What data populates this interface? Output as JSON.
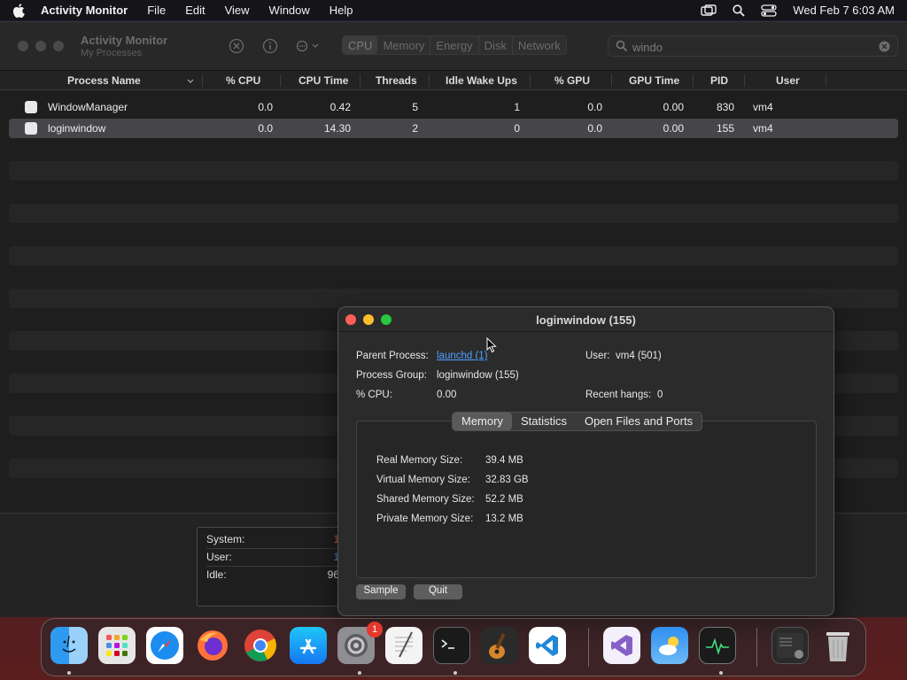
{
  "menubar": {
    "app_name": "Activity Monitor",
    "items": [
      "File",
      "Edit",
      "View",
      "Window",
      "Help"
    ],
    "clock": "Wed Feb 7  6:03 AM"
  },
  "toolbar": {
    "title": "Activity Monitor",
    "subtitle": "My Processes",
    "tabs": [
      "CPU",
      "Memory",
      "Energy",
      "Disk",
      "Network"
    ],
    "active_tab": "CPU",
    "search_value": "windo"
  },
  "table": {
    "columns": [
      "Process Name",
      "% CPU",
      "CPU Time",
      "Threads",
      "Idle Wake Ups",
      "% GPU",
      "GPU Time",
      "PID",
      "User"
    ],
    "rows": [
      {
        "name": "WindowManager",
        "cpu": "0.0",
        "cpu_time": "0.42",
        "threads": "5",
        "idle_wake": "1",
        "gpu": "0.0",
        "gpu_time": "0.00",
        "pid": "830",
        "user": "vm4"
      },
      {
        "name": "loginwindow",
        "cpu": "0.0",
        "cpu_time": "14.30",
        "threads": "2",
        "idle_wake": "0",
        "gpu": "0.0",
        "gpu_time": "0.00",
        "pid": "155",
        "user": "vm4"
      }
    ]
  },
  "cpu_load": {
    "system_label": "System:",
    "system_value": "1",
    "user_label": "User:",
    "user_value": "1",
    "idle_label": "Idle:",
    "idle_value": "96",
    "system_color": "#e5533c",
    "user_color": "#4a90e2"
  },
  "inspector": {
    "title": "loginwindow (155)",
    "parent_label": "Parent Process:",
    "parent_value": "launchd (1)",
    "user_label": "User:",
    "user_value": "vm4 (501)",
    "group_label": "Process Group:",
    "group_value": "loginwindow (155)",
    "cpu_label": "% CPU:",
    "cpu_value": "0.00",
    "hangs_label": "Recent hangs:",
    "hangs_value": "0",
    "tabs": [
      "Memory",
      "Statistics",
      "Open Files and Ports"
    ],
    "active_tab": "Memory",
    "memory": [
      {
        "label": "Real Memory Size:",
        "value": "39.4 MB"
      },
      {
        "label": "Virtual Memory Size:",
        "value": "32.83 GB"
      },
      {
        "label": "Shared Memory Size:",
        "value": "52.2 MB"
      },
      {
        "label": "Private Memory Size:",
        "value": "13.2 MB"
      }
    ],
    "sample_label": "Sample",
    "quit_label": "Quit"
  },
  "dock": {
    "apps": [
      "finder-icon",
      "launchpad-icon",
      "safari-icon",
      "firefox-icon",
      "chrome-icon",
      "app-store-icon",
      "system-settings-icon",
      "textedit-icon",
      "terminal-icon",
      "garageband-icon",
      "vscode-icon",
      "visual-studio-icon",
      "weather-icon",
      "activity-monitor-icon",
      "window-preview-icon",
      "trash-icon"
    ],
    "settings_badge": "1"
  }
}
